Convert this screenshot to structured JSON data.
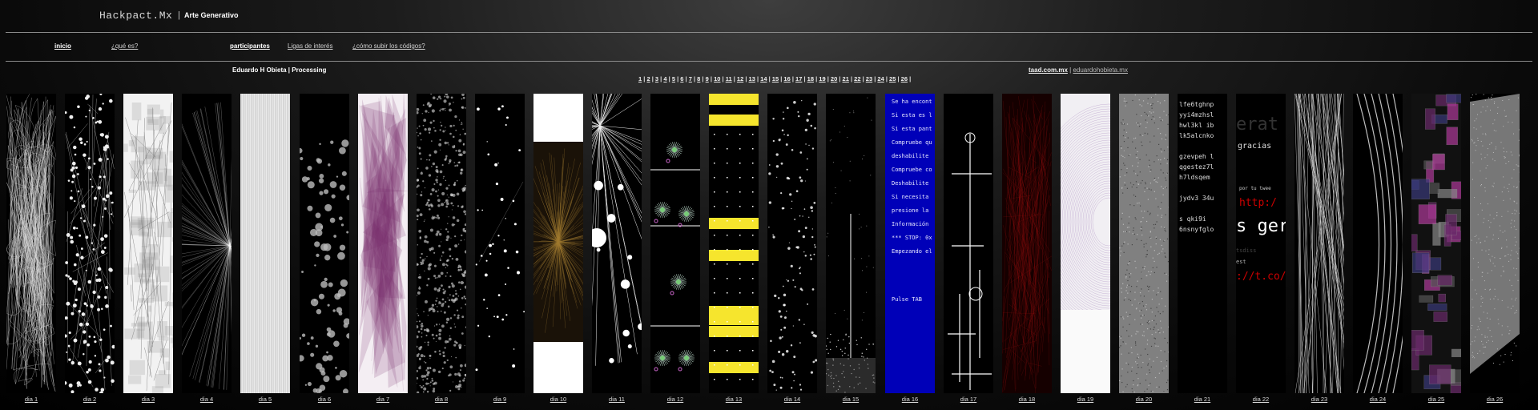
{
  "header": {
    "title": "Hackpact.Mx",
    "separator": "|",
    "subtitle": "Arte Generativo"
  },
  "nav": {
    "home": "inicio",
    "about": "¿qué es?",
    "participants": "participantes",
    "links": "Ligas de interés",
    "upload": "¿cómo subir los códigos?"
  },
  "author": {
    "name": "Eduardo H Obieta",
    "separator": "|",
    "tool": "Processing"
  },
  "pager": [
    "1",
    "2",
    "3",
    "4",
    "5",
    "6",
    "7",
    "8",
    "9",
    "10",
    "11",
    "12",
    "13",
    "14",
    "15",
    "16",
    "17",
    "18",
    "19",
    "20",
    "21",
    "22",
    "23",
    "24",
    "25",
    "26"
  ],
  "external_links": {
    "site1": "taad.com.mx",
    "separator": "|",
    "site2": "eduardohobieta.mx"
  },
  "strip_captions": [
    "dia 1",
    "dia 2",
    "dia 3",
    "dia 4",
    "dia 5",
    "dia 6",
    "dia 7",
    "dia 8",
    "dia 9",
    "dia 10",
    "dia 11",
    "dia 12",
    "dia 13",
    "dia 14",
    "dia 15",
    "dia 16",
    "dia 17",
    "dia 18",
    "dia 19",
    "dia 20",
    "dia 21",
    "dia 22",
    "dia 23",
    "dia 24",
    "dia 25",
    "dia 26"
  ],
  "strip_texts": {
    "dia16": [
      "Se ha encont",
      "Si esta es l",
      "Si esta pant",
      "Compruebe qu",
      "deshabilite",
      "Compruebe co",
      "Deshabilite",
      "Si necesita",
      "presione la",
      "Información",
      "*** STOP: 0x",
      "Empezando el",
      "",
      "Pulse TAB"
    ],
    "dia21": [
      "lfe6tghnp",
      "yyi4mzhsl",
      "hwl3kl ib",
      "lk5alcnko",
      "",
      "gzevpeh l",
      "qgestez7l",
      "h7ldsqem",
      "",
      "jydv3 34u",
      "",
      "s  qki9i",
      "6nsnyfglo"
    ],
    "dia22": [
      "erat",
      "gracias",
      "por tu twee",
      "http:/",
      "s ger",
      "tsdiss",
      "est",
      "://t.co/"
    ]
  },
  "colors": {
    "background": "#000000",
    "bsod_blue": "#0000b8",
    "yellow": "#f6e52d",
    "purple": "#7a2f6e",
    "red": "#b01010"
  }
}
